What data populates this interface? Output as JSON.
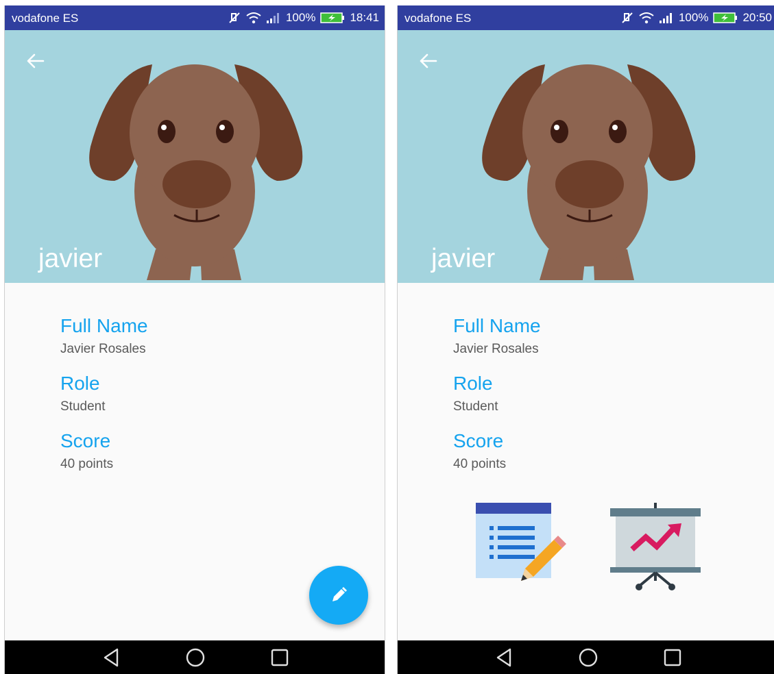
{
  "screens": [
    {
      "status_bar": {
        "carrier": "vodafone ES",
        "battery": "100%",
        "time": "18:41"
      },
      "header": {
        "name": "javier",
        "back_icon": "arrow-back-icon",
        "avatar": "dog-avatar"
      },
      "details": [
        {
          "label": "Full Name",
          "value": "Javier Rosales"
        },
        {
          "label": "Role",
          "value": "Student"
        },
        {
          "label": "Score",
          "value": "40 points"
        }
      ],
      "fab": {
        "icon": "pencil-icon",
        "color": "#14aaf5"
      },
      "nav": [
        "back-triangle-icon",
        "home-circle-icon",
        "recents-square-icon"
      ]
    },
    {
      "status_bar": {
        "carrier": "vodafone ES",
        "battery": "100%",
        "time": "20:50"
      },
      "header": {
        "name": "javier",
        "back_icon": "arrow-back-icon",
        "avatar": "dog-avatar"
      },
      "details": [
        {
          "label": "Full Name",
          "value": "Javier Rosales"
        },
        {
          "label": "Role",
          "value": "Student"
        },
        {
          "label": "Score",
          "value": "40 points"
        }
      ],
      "feature_icons": [
        "list-edit-icon",
        "presentation-chart-icon"
      ],
      "nav": [
        "back-triangle-icon",
        "home-circle-icon",
        "recents-square-icon"
      ]
    }
  ],
  "colors": {
    "status_bar": "#303f9f",
    "header_bg": "#a4d4de",
    "label": "#15a3ee",
    "value": "#5a5a5a",
    "nav_bar": "#000000"
  }
}
